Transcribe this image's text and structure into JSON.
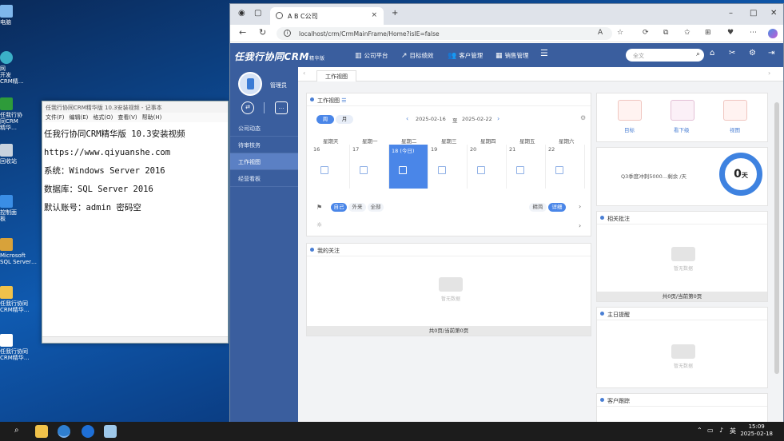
{
  "desktop": {
    "icons": [
      "电脑",
      "网\n开发\nCRM精…",
      "任我行协\n同CRM\n精华…",
      "回收站",
      "控制面\n板",
      "Microsoft\nSQL Server…",
      "任我行协同\nCRM精华…",
      "任我行协同\nCRM精华…"
    ]
  },
  "notepad": {
    "title": "任我行协同CRM精华版 10.3安装视频 - 记事本",
    "menu": [
      "文件(F)",
      "编辑(E)",
      "格式(O)",
      "查看(V)",
      "帮助(H)"
    ],
    "lines": [
      "任我行协同CRM精华版 10.3安装视频",
      "https://www.qiyuanshe.com",
      "系统：Windows Server 2016",
      "数据库：SQL Server 2016",
      "默认账号：admin 密码空"
    ]
  },
  "browser": {
    "tab_title": "A B C公司",
    "tab_close": "×",
    "new_tab": "+",
    "url": "localhost/crm/CrmMainFrame/Home?isIE=false",
    "window_controls": [
      "–",
      "□",
      "✕"
    ]
  },
  "crm": {
    "logo": "任我行协同CRM",
    "logo_small": "精华版",
    "nav": [
      {
        "icon": "bar-chart-icon",
        "label": "公司平台"
      },
      {
        "icon": "trend-icon",
        "label": "目标绩效"
      },
      {
        "icon": "users-icon",
        "label": "客户管理"
      },
      {
        "icon": "sales-icon",
        "label": "销售管理"
      }
    ],
    "menu_icon": "☰",
    "search_placeholder": "全文",
    "user_label": "管理员",
    "sidebar_items": [
      "公司动态",
      "待审核务",
      "工作视图",
      "经营看板"
    ],
    "active_sidebar": "工作视图",
    "content_tab": "工作视图",
    "work_view": {
      "title": "工作视图",
      "day_btn": "周",
      "month_btn": "月",
      "date_from": "2025-02-16",
      "to_label": "至",
      "date_to": "2025-02-22",
      "weekdays": [
        "星期天",
        "星期一",
        "星期二",
        "星期三",
        "星期四",
        "星期五",
        "星期六"
      ],
      "days": [
        "16",
        "17",
        "18 (今日)",
        "19",
        "20",
        "21",
        "22"
      ],
      "filters": [
        "自己",
        "外来",
        "全部"
      ],
      "right_filters": [
        "精简",
        "详细"
      ]
    },
    "my_follow": {
      "title": "我的关注",
      "empty": "暂无数据",
      "footer": "共0页/当前第0页"
    },
    "quick": [
      {
        "icon": "target-icon",
        "label": "目标"
      },
      {
        "icon": "subordinate-icon",
        "label": "看下级"
      },
      {
        "icon": "view-icon",
        "label": "视图"
      }
    ],
    "kpi": {
      "text": "Q3季度冲刺5000…剩余 /天",
      "value": "0",
      "unit": "天"
    },
    "related": {
      "title": "相关批注",
      "empty": "暂无数据",
      "footer": "共0页/当前第0页"
    },
    "reminder": {
      "title": "主日提醒",
      "empty": "暂无数据"
    },
    "customer": {
      "title": "客户跟踪"
    }
  },
  "taskbar": {
    "tray_text": "英",
    "time": "15:09",
    "date": "2025-02-18"
  },
  "colors": {
    "crm_blue": "#3a5e9e",
    "accent": "#4a86e8"
  }
}
